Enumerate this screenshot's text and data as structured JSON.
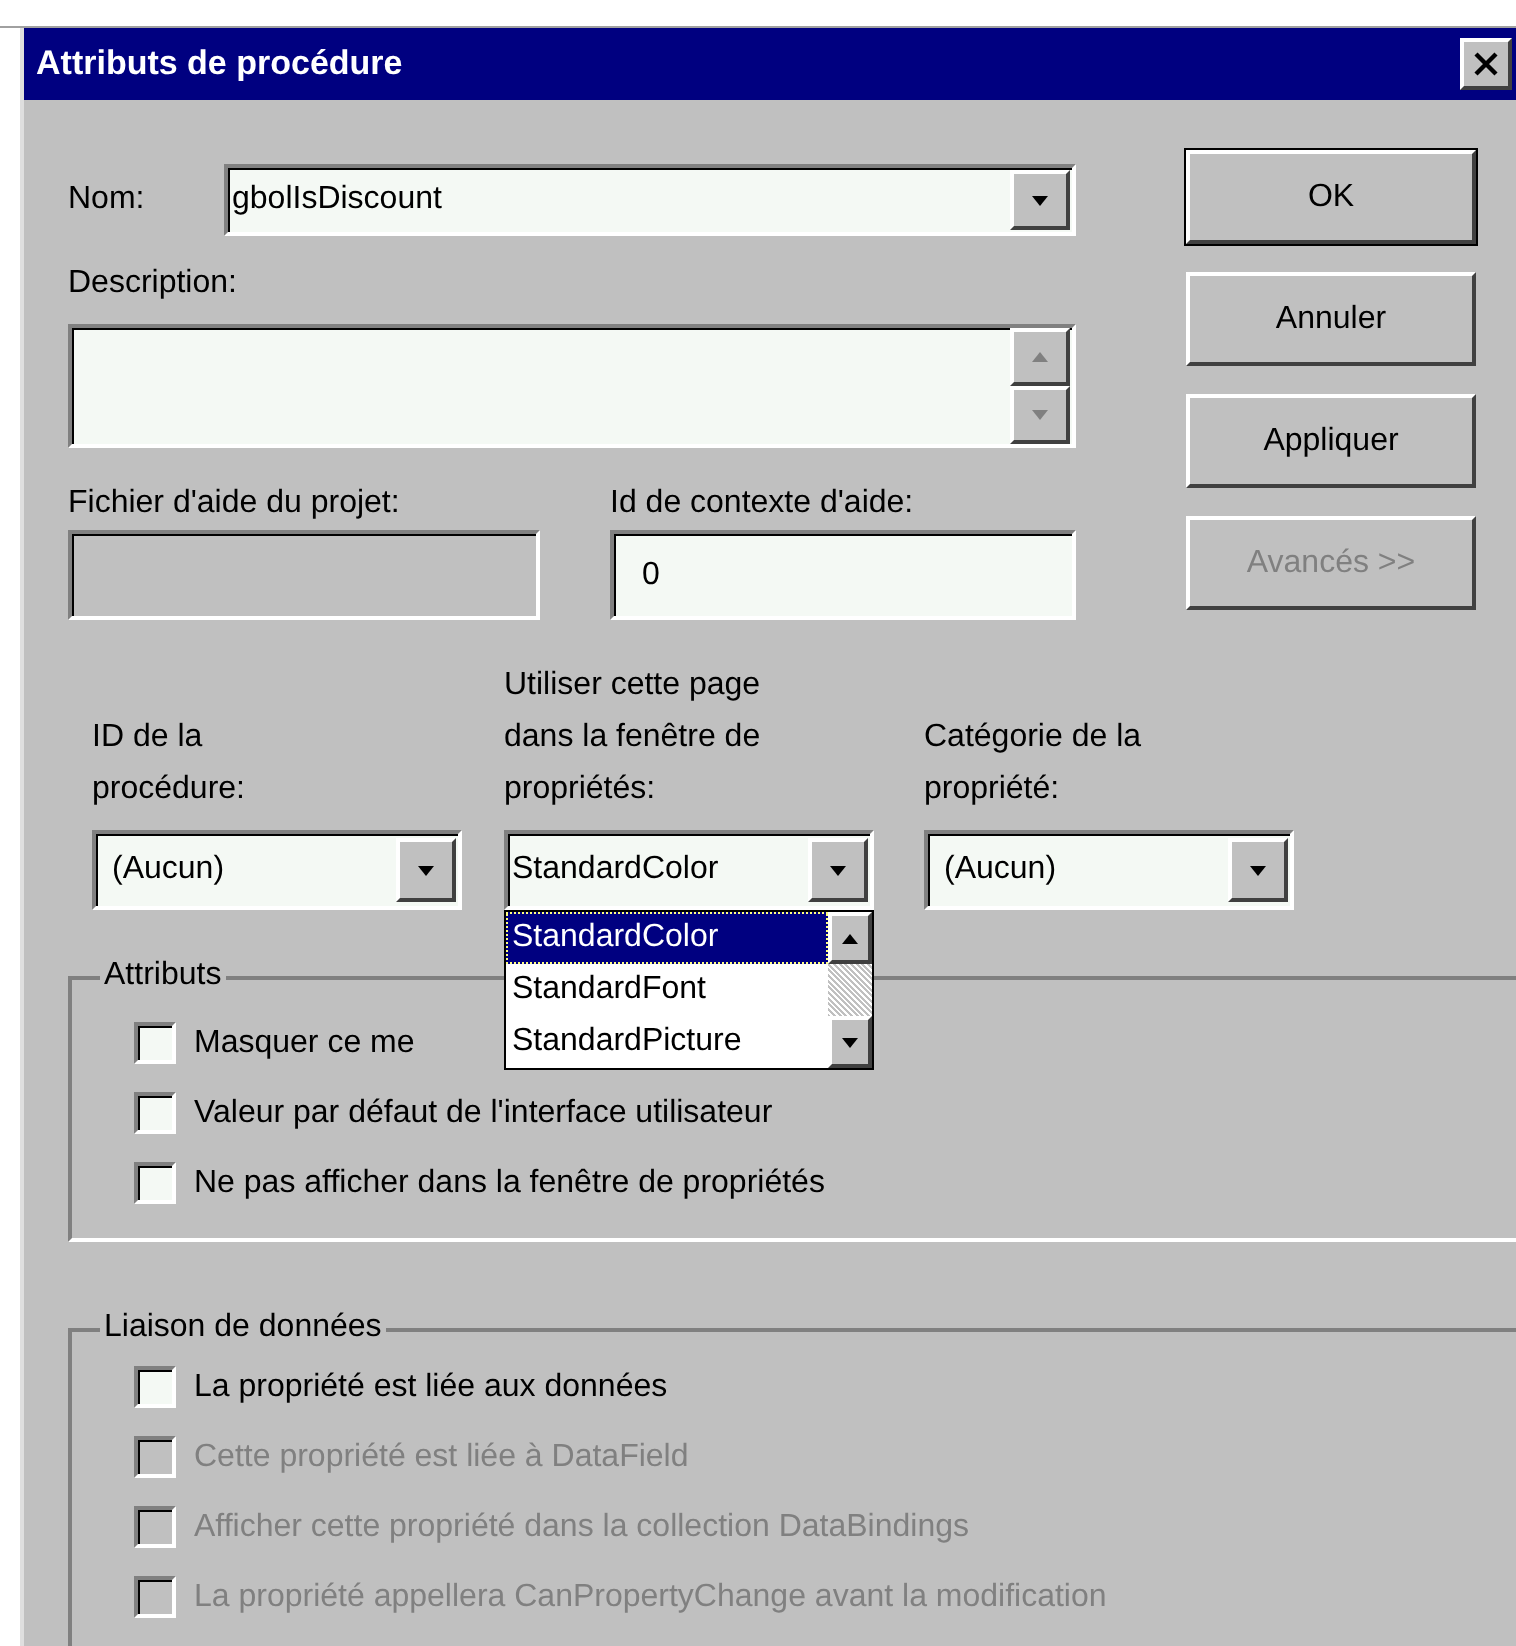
{
  "window": {
    "title": "Attributs de procédure"
  },
  "fields": {
    "name": {
      "label": "Nom:",
      "value": "gbolIsDiscount"
    },
    "description": {
      "label": "Description:"
    },
    "help_file": {
      "label": "Fichier d'aide du projet:",
      "disabled": true
    },
    "help_context_id": {
      "label": "Id de contexte d'aide:",
      "value": "0",
      "disabled": false
    }
  },
  "buttons": [
    {
      "label": "OK",
      "disabled": false,
      "default": true
    },
    {
      "label": "Annuler",
      "disabled": false,
      "default": false
    },
    {
      "label": "Appliquer",
      "disabled": false,
      "default": false
    },
    {
      "label": "Avancés >>",
      "disabled": true,
      "default": false
    }
  ],
  "dropdowns": [
    {
      "label": "ID de la procédure:",
      "value": "(Aucun)",
      "expanded": false
    },
    {
      "label": "Utiliser cette page dans la fenêtre de propriétés:",
      "value": "StandardColor",
      "expanded": true,
      "options": [
        {
          "label": "StandardColor",
          "selected": true
        },
        {
          "label": "StandardFont",
          "selected": false
        },
        {
          "label": "StandardPicture",
          "selected": false
        }
      ]
    },
    {
      "label": "Catégorie de la propriété:",
      "value": "(Aucun)",
      "expanded": false
    }
  ],
  "groups": [
    {
      "title": "Attributs",
      "options": [
        {
          "label": "Masquer ce me",
          "checked": false,
          "disabled": false
        },
        {
          "label": "Valeur par défaut de l'interface utilisateur",
          "checked": false,
          "disabled": false
        },
        {
          "label": "Ne pas afficher dans la fenêtre de propriétés",
          "checked": false,
          "disabled": false
        }
      ]
    },
    {
      "title": "Liaison de données",
      "options": [
        {
          "label": "La propriété est liée aux données",
          "checked": false,
          "disabled": false
        },
        {
          "label": "Cette propriété est liée à DataField",
          "checked": false,
          "disabled": true
        },
        {
          "label": "Afficher cette propriété dans la collection DataBindings",
          "checked": false,
          "disabled": true
        },
        {
          "label": "La propriété appellera CanPropertyChange avant la modification",
          "checked": false,
          "disabled": true
        }
      ]
    }
  ]
}
